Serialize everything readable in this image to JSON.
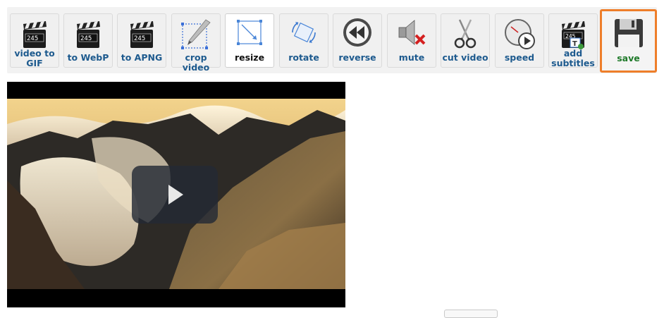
{
  "toolbar": {
    "items": [
      {
        "label": "video to GIF",
        "icon": "clapperboard-icon"
      },
      {
        "label": "to WebP",
        "icon": "clapperboard-icon"
      },
      {
        "label": "to APNG",
        "icon": "clapperboard-icon"
      },
      {
        "label": "crop video",
        "icon": "crop-icon"
      },
      {
        "label": "resize",
        "icon": "resize-icon",
        "active": true
      },
      {
        "label": "rotate",
        "icon": "rotate-icon"
      },
      {
        "label": "reverse",
        "icon": "rewind-icon"
      },
      {
        "label": "mute",
        "icon": "speaker-mute-icon"
      },
      {
        "label": "cut video",
        "icon": "scissors-icon"
      },
      {
        "label": "speed",
        "icon": "stopwatch-icon"
      },
      {
        "label": "add subtitles",
        "icon": "subtitles-icon"
      },
      {
        "label": "save",
        "icon": "floppy-disk-icon",
        "highlight": "#ee7e2a"
      }
    ],
    "clapper_text": "2 4 5"
  },
  "video": {
    "play_icon": "play-icon"
  },
  "colors": {
    "link": "#1d5a8e",
    "save_text": "#1f7a2a",
    "save_border": "#ee7e2a"
  }
}
